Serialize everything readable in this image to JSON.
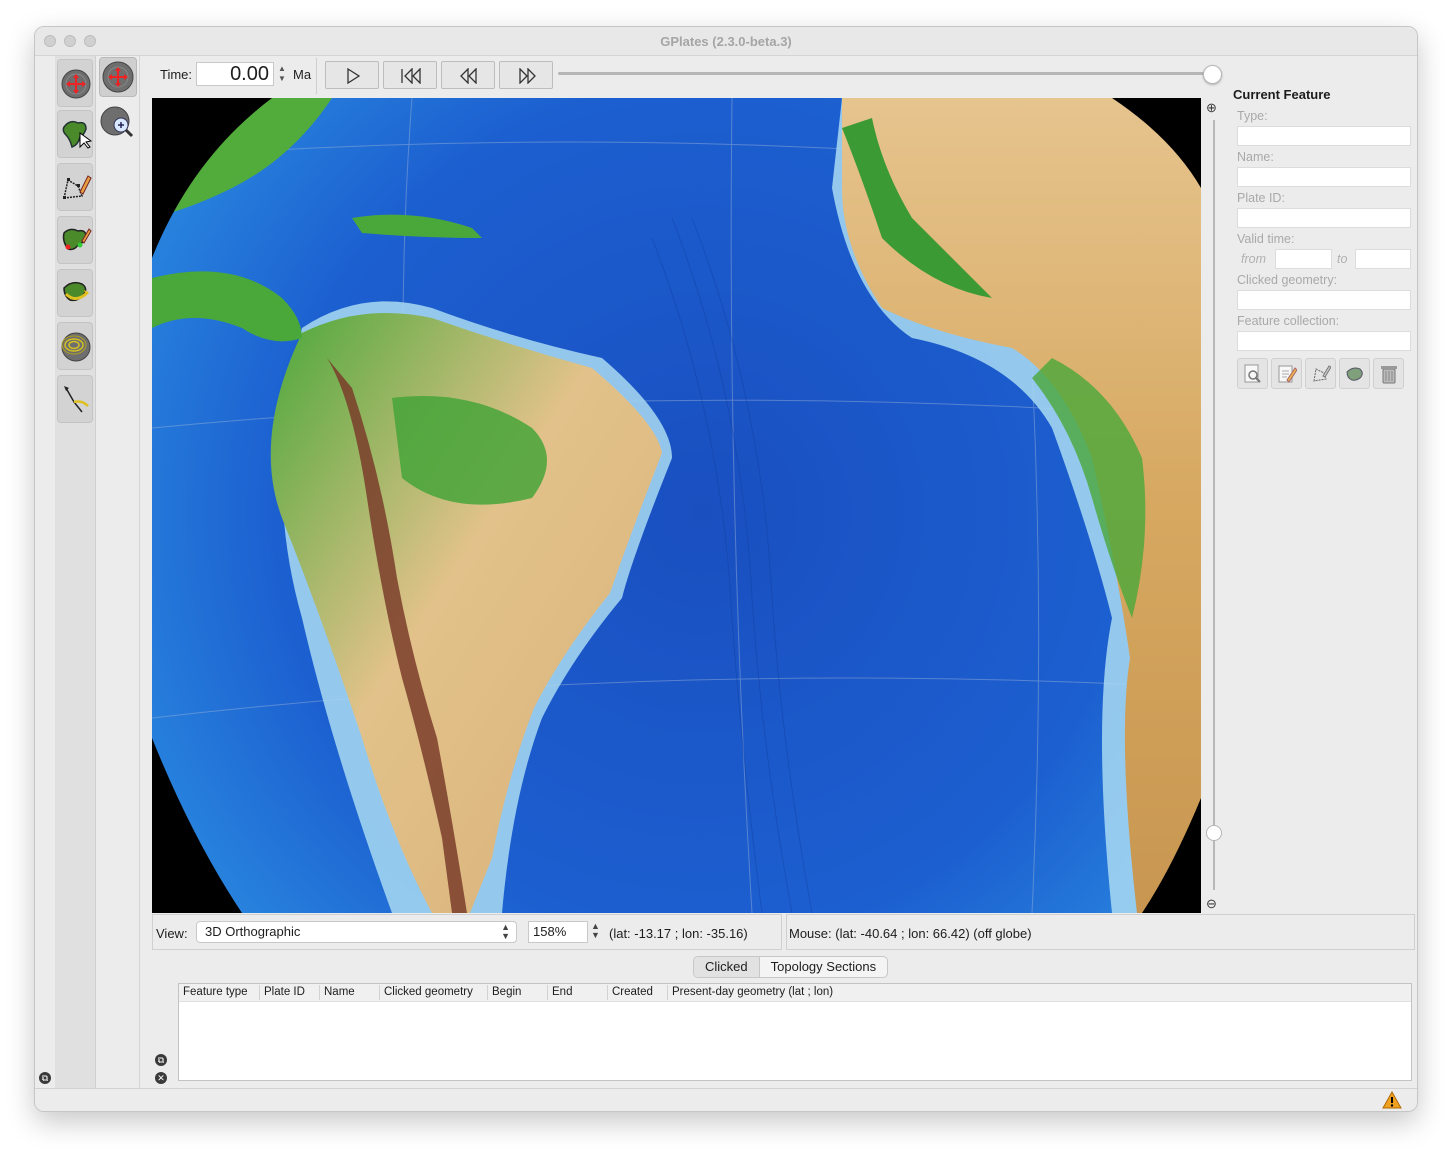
{
  "window": {
    "title": "GPlates (2.3.0-beta.3)"
  },
  "tools": {
    "primary": [
      "drag-globe-icon",
      "choose-feature-icon",
      "digitise-geometry-icon",
      "build-topology-icon",
      "manipulate-pole-icon",
      "small-circle-icon",
      "measure-distance-icon"
    ],
    "secondary": [
      "drag-globe-icon",
      "zoom-globe-icon"
    ]
  },
  "time": {
    "label": "Time:",
    "value": "0.00",
    "unit": "Ma",
    "buttons": [
      "play-icon",
      "reset-icon",
      "rewind-icon",
      "fast-forward-icon"
    ],
    "slider_fraction": 1.0
  },
  "view": {
    "label": "View:",
    "projection": "3D Orthographic",
    "zoom": "158%",
    "camera": "(lat: -13.17 ; lon: -35.16)",
    "mouse": "Mouse: (lat: -40.64 ; lon: 66.42) (off globe)"
  },
  "current_feature": {
    "title": "Current Feature",
    "type_label": "Type:",
    "name_label": "Name:",
    "plate_id_label": "Plate ID:",
    "valid_time_label": "Valid time:",
    "from_label": "from",
    "to_label": "to",
    "clicked_geometry_label": "Clicked geometry:",
    "feature_collection_label": "Feature collection:",
    "actions": [
      "query-feature-icon",
      "edit-feature-icon",
      "clone-geometry-icon",
      "reconstruct-icon",
      "delete-feature-icon"
    ]
  },
  "tabs": {
    "clicked": "Clicked",
    "topology_sections": "Topology Sections"
  },
  "table": {
    "columns": [
      "Feature type",
      "Plate ID",
      "Name",
      "Clicked geometry",
      "Begin",
      "End",
      "Created",
      "Present-day geometry (lat ; lon)"
    ],
    "rows": []
  },
  "colors": {
    "ocean_deep": "#1947b8",
    "ocean_mid": "#2f7fe0",
    "shelf": "#a8d8f0",
    "lowland": "#3aa33a",
    "upland": "#e0c08a",
    "mountain": "#7a3d2a"
  }
}
